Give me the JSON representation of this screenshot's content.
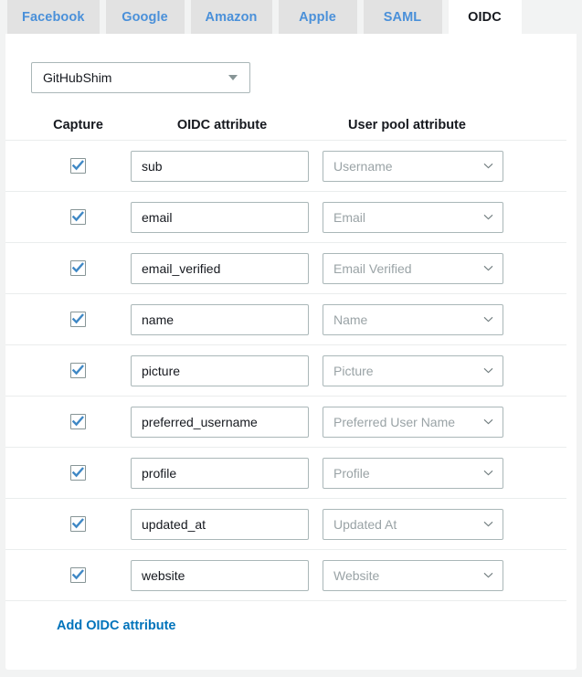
{
  "tabs": [
    {
      "label": "Facebook",
      "active": false
    },
    {
      "label": "Google",
      "active": false
    },
    {
      "label": "Amazon",
      "active": false
    },
    {
      "label": "Apple",
      "active": false
    },
    {
      "label": "SAML",
      "active": false
    },
    {
      "label": "OIDC",
      "active": true
    }
  ],
  "provider_select": {
    "value": "GitHubShim",
    "icon": "caret-down-icon"
  },
  "table": {
    "headers": {
      "capture": "Capture",
      "oidc_attribute": "OIDC attribute",
      "user_pool_attribute": "User pool attribute"
    },
    "rows": [
      {
        "captured": true,
        "oidc_attribute": "sub",
        "user_pool_attribute": "Username"
      },
      {
        "captured": true,
        "oidc_attribute": "email",
        "user_pool_attribute": "Email"
      },
      {
        "captured": true,
        "oidc_attribute": "email_verified",
        "user_pool_attribute": "Email Verified"
      },
      {
        "captured": true,
        "oidc_attribute": "name",
        "user_pool_attribute": "Name"
      },
      {
        "captured": true,
        "oidc_attribute": "picture",
        "user_pool_attribute": "Picture"
      },
      {
        "captured": true,
        "oidc_attribute": "preferred_username",
        "user_pool_attribute": "Preferred User Name"
      },
      {
        "captured": true,
        "oidc_attribute": "profile",
        "user_pool_attribute": "Profile"
      },
      {
        "captured": true,
        "oidc_attribute": "updated_at",
        "user_pool_attribute": "Updated At"
      },
      {
        "captured": true,
        "oidc_attribute": "website",
        "user_pool_attribute": "Website"
      }
    ]
  },
  "footer": {
    "add_attribute_label": "Add OIDC attribute"
  },
  "colors": {
    "tab_link": "#4a90d9",
    "tab_inactive_bg": "#e2e2e2",
    "active_tab_bg": "#ffffff",
    "page_bg": "#f2f3f3",
    "link": "#0073bb",
    "checkbox_check": "#3f88c5",
    "border": "#aab7b8",
    "row_divider": "#eaeded",
    "placeholder_text": "#9aa3a6"
  }
}
